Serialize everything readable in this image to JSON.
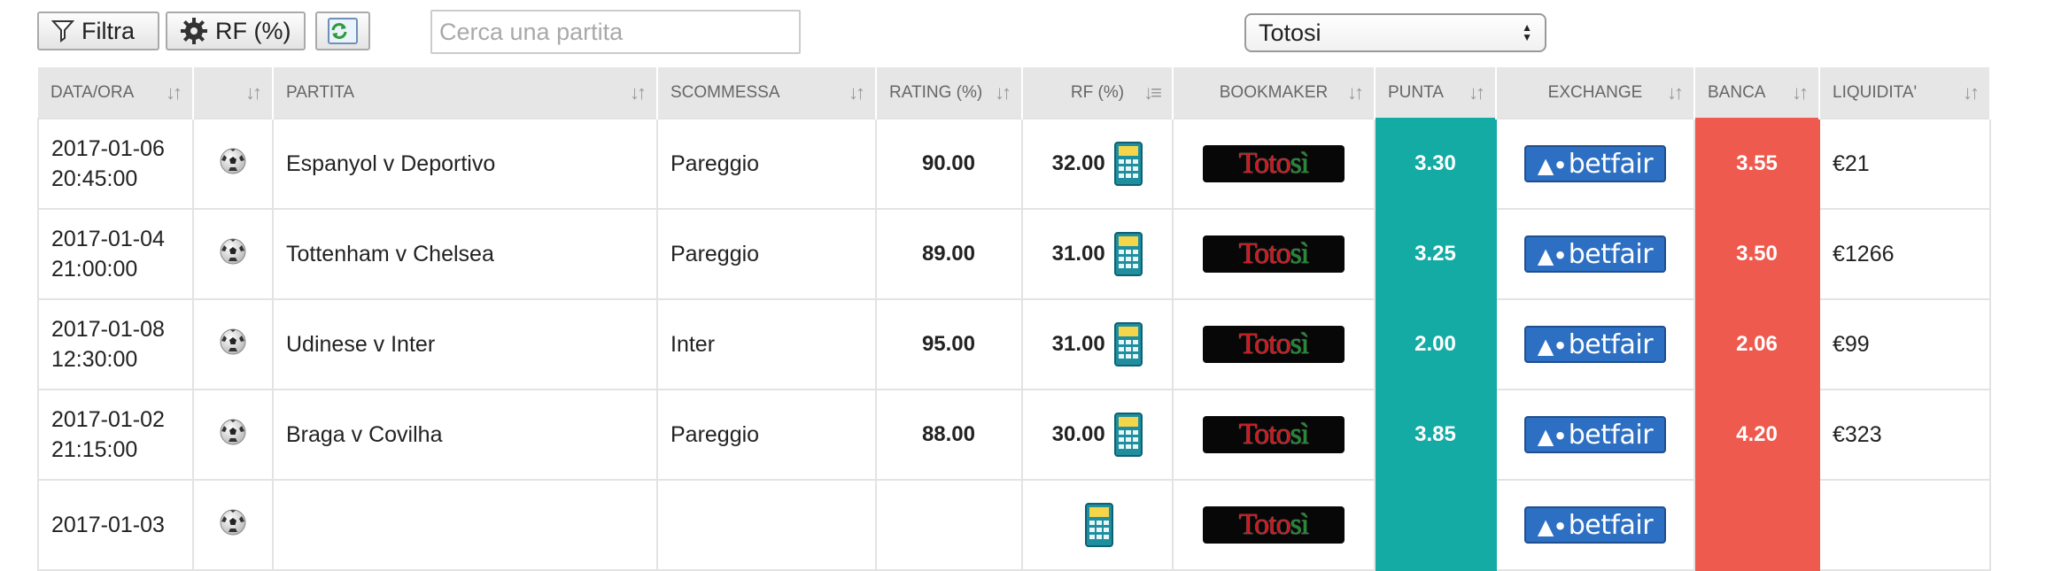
{
  "toolbar": {
    "filter_label": "Filtra",
    "rf_label": "RF (%)",
    "search_placeholder": "Cerca una partita",
    "bookmaker_select": "Totosi"
  },
  "table": {
    "headers": [
      "DATA/ORA",
      "",
      "PARTITA",
      "SCOMMESSA",
      "RATING (%)",
      "RF (%)",
      "BOOKMAKER",
      "PUNTA",
      "EXCHANGE",
      "BANCA",
      "LIQUIDITA'"
    ],
    "rows": [
      {
        "date": "2017-01-06",
        "time": "20:45:00",
        "match": "Espanyol v Deportivo",
        "bet": "Pareggio",
        "rating": "90.00",
        "rf": "32.00",
        "punta": "3.30",
        "banca": "3.55",
        "liquidity": "€21"
      },
      {
        "date": "2017-01-04",
        "time": "21:00:00",
        "match": "Tottenham v Chelsea",
        "bet": "Pareggio",
        "rating": "89.00",
        "rf": "31.00",
        "punta": "3.25",
        "banca": "3.50",
        "liquidity": "€1266"
      },
      {
        "date": "2017-01-08",
        "time": "12:30:00",
        "match": "Udinese v Inter",
        "bet": "Inter",
        "rating": "95.00",
        "rf": "31.00",
        "punta": "2.00",
        "banca": "2.06",
        "liquidity": "€99"
      },
      {
        "date": "2017-01-02",
        "time": "21:15:00",
        "match": "Braga v Covilha",
        "bet": "Pareggio",
        "rating": "88.00",
        "rf": "30.00",
        "punta": "3.85",
        "banca": "4.20",
        "liquidity": "€323"
      },
      {
        "date": "2017-01-03",
        "time": "",
        "match": "",
        "bet": "",
        "rating": "",
        "rf": "",
        "punta": "",
        "banca": "",
        "liquidity": ""
      }
    ]
  },
  "logos": {
    "bookmaker": "Totosi",
    "exchange": "betfair"
  },
  "colors": {
    "punta": "#14aba5",
    "banca": "#ef5a4e"
  },
  "icons": {
    "filter": "filter-icon",
    "rf": "gear-icon",
    "refresh": "refresh-icon",
    "sport": "soccer-ball-icon",
    "calc": "calculator-icon"
  }
}
